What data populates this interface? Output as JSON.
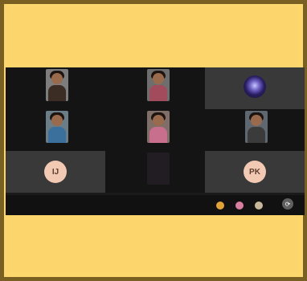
{
  "participants": [
    {
      "name": "",
      "initials": ""
    },
    {
      "name": "",
      "initials": ""
    },
    {
      "name": "",
      "initials": ""
    },
    {
      "name": "",
      "initials": ""
    },
    {
      "name": "",
      "initials": ""
    },
    {
      "name": "",
      "initials": ""
    },
    {
      "name": "",
      "initials": "IJ"
    },
    {
      "name": "",
      "initials": ""
    },
    {
      "name": "",
      "initials": "PK"
    }
  ],
  "toolbar": {
    "icons": [
      "emoji-icon",
      "reaction-icon",
      "presentation-icon",
      "refresh-icon"
    ]
  },
  "colors": {
    "background": "#fcd76d",
    "frame": "#7a5f22",
    "meeting_bg": "#1b1b1b",
    "tile_dark": "#141414",
    "tile_gray": "#393939",
    "avatar_bg": "#f2c9b3",
    "avatar_text": "#5c3d2f"
  }
}
